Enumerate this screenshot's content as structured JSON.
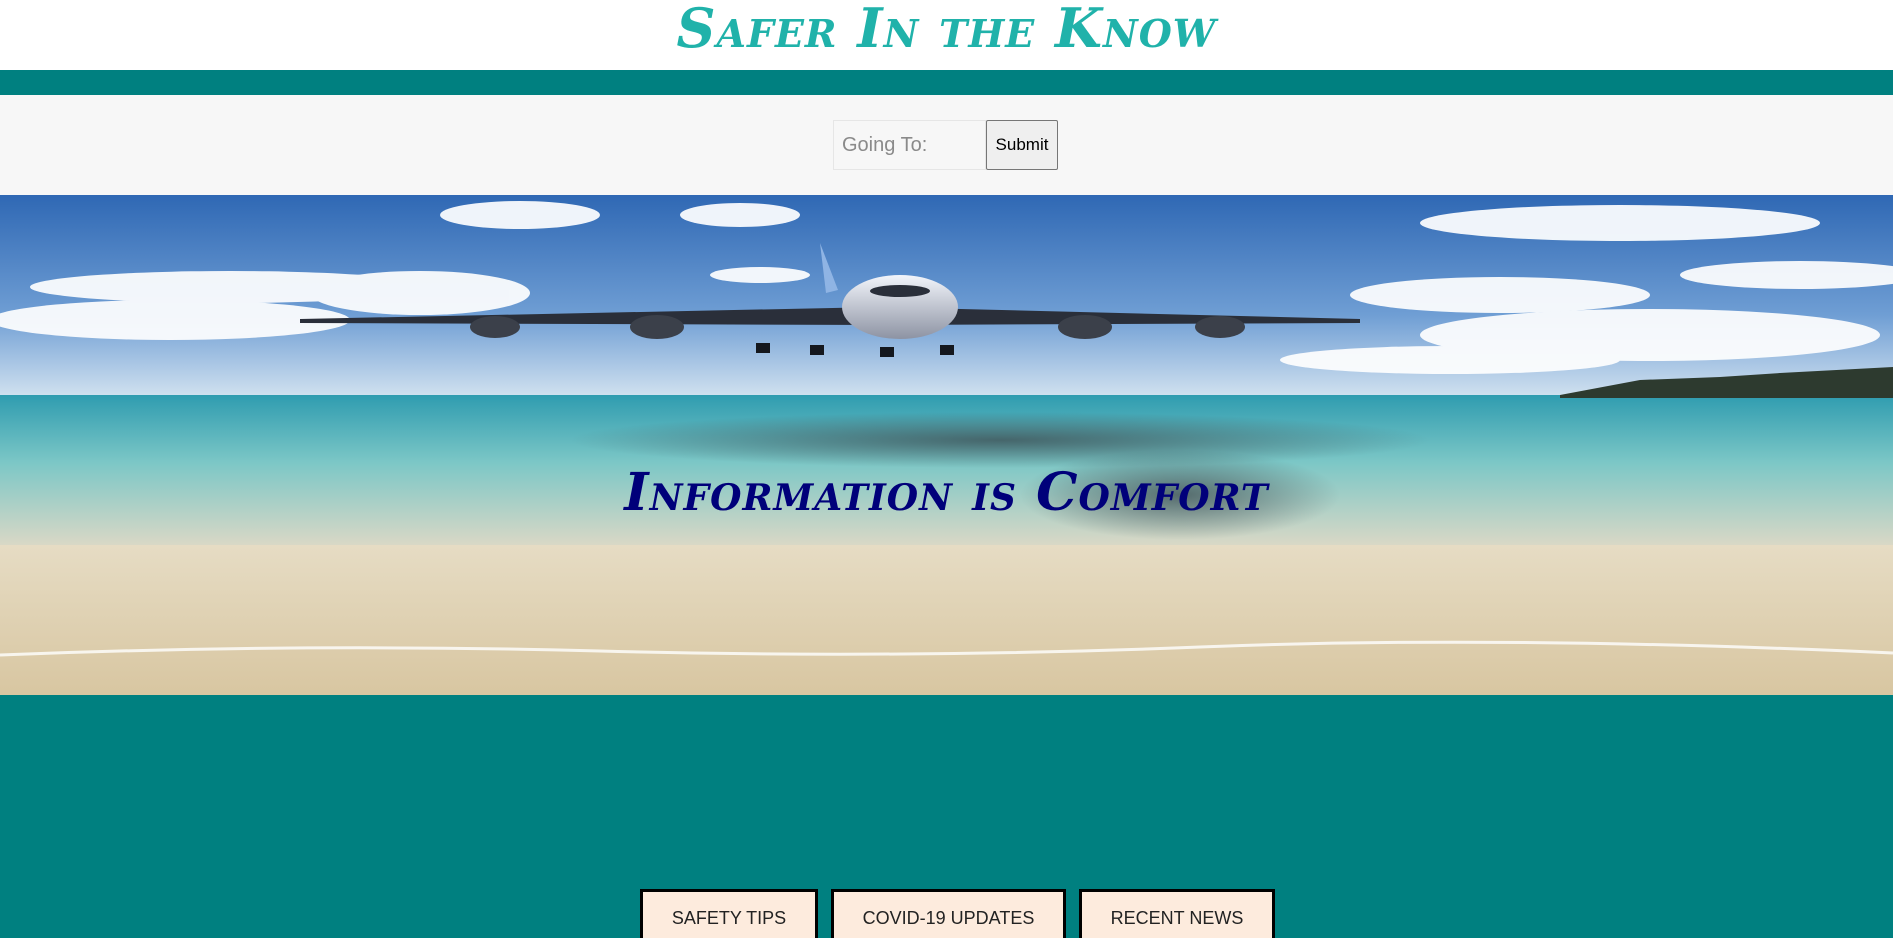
{
  "header": {
    "site_title": "Safer In the Know"
  },
  "search": {
    "placeholder": "Going To:",
    "value": "",
    "submit_label": "Submit"
  },
  "hero": {
    "tagline": "Information is Comfort",
    "image": "airplane-over-beach"
  },
  "nav_buttons": [
    {
      "label": "SAFETY TIPS"
    },
    {
      "label": "COVID-19 UPDATES"
    },
    {
      "label": "RECENT NEWS"
    }
  ],
  "colors": {
    "brand_teal": "#008080",
    "title_teal": "#20b2aa",
    "tagline_navy": "#00007a",
    "button_cream": "#fdebdd"
  }
}
